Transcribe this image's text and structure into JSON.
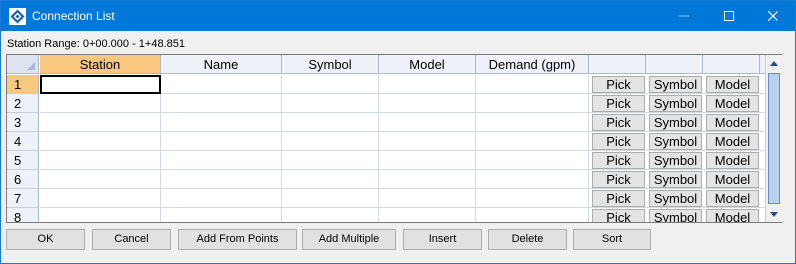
{
  "window": {
    "title": "Connection List",
    "controls": {
      "minimize": "minimize-icon",
      "maximize": "maximize-icon",
      "close": "close-icon"
    }
  },
  "station_range": "Station Range: 0+00.000 - 1+48.851",
  "grid": {
    "columns": [
      "Station",
      "Name",
      "Symbol",
      "Model",
      "Demand (gpm)"
    ],
    "rows": [
      "1",
      "2",
      "3",
      "4",
      "5",
      "6",
      "7",
      "8"
    ],
    "row_buttons": [
      "Pick",
      "Symbol",
      "Model"
    ],
    "active_row": "1",
    "active_column": "Station"
  },
  "buttons": {
    "ok": "OK",
    "cancel": "Cancel",
    "add_from_points": "Add From Points",
    "add_multiple": "Add Multiple",
    "insert": "Insert",
    "delete": "Delete",
    "sort": "Sort"
  },
  "colors": {
    "titlebar": "#0078d7",
    "active_header": "#f8c880",
    "scroll_thumb": "#b9d1ea"
  }
}
